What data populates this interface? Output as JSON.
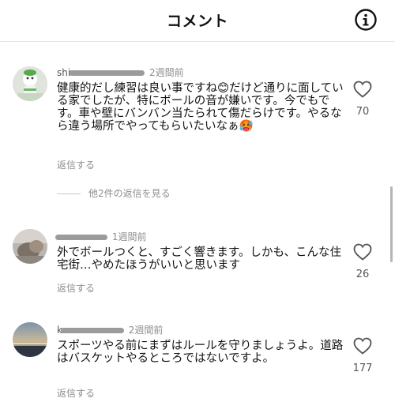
{
  "header": {
    "title": "コメント",
    "info_icon": "info-icon"
  },
  "comments": [
    {
      "username_visible": "shi",
      "time": "2週間前",
      "text": "健康的だし練習は良い事ですね😊だけど通りに面している家でしたが、特にボールの音が嫌いです。今でもです。車や壁にバンバン当たられて傷だらけです。やるなら違う場所でやってもらいたいなぁ🥵",
      "reply_label": "返信する",
      "likes": "70",
      "more_replies": "他2件の返信を見る"
    },
    {
      "username_visible": "",
      "time": "1週間前",
      "text": "外でボールつくと、すごく響きます。しかも、こんな住宅街…やめたほうがいいと思います",
      "reply_label": "返信する",
      "likes": "26"
    },
    {
      "username_visible": "k",
      "time": "2週間前",
      "text": "スポーツやる前にまずはルールを守りましょうよ。道路はバスケットやるところではないですよ。",
      "reply_label": "返信する",
      "likes": "177"
    }
  ],
  "colors": {
    "secondary_text": "#8e8e8e",
    "divider": "#e6e6e6"
  }
}
